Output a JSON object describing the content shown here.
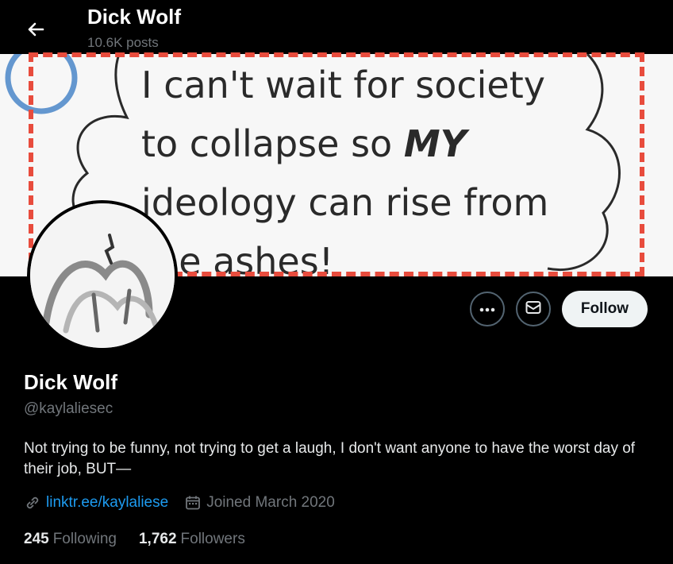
{
  "header": {
    "title": "Dick Wolf",
    "posts_count": "10.6K posts",
    "back_icon": "arrow-left-icon"
  },
  "banner": {
    "line1": "I can't wait for society",
    "line2_a": "to collapse so ",
    "line2_b": "MY",
    "line3": "ideology can rise from",
    "line4": "the ashes!",
    "highlight_color": "#e84c3d"
  },
  "actions": {
    "more_icon": "more-dots-icon",
    "message_icon": "envelope-icon",
    "follow_label": "Follow"
  },
  "profile": {
    "name": "Dick Wolf",
    "handle": "@kaylaliesec",
    "bio": "Not trying to be funny, not trying to get a laugh, I don't want anyone to have the worst day of their job, BUT—",
    "link": "linktr.ee/kaylaliese",
    "joined": "Joined March 2020"
  },
  "stats": {
    "following_count": "245",
    "following_label": "Following",
    "followers_count": "1,762",
    "followers_label": "Followers"
  },
  "colors": {
    "background": "#000000",
    "link": "#1d9bf0",
    "muted": "#71767b"
  }
}
